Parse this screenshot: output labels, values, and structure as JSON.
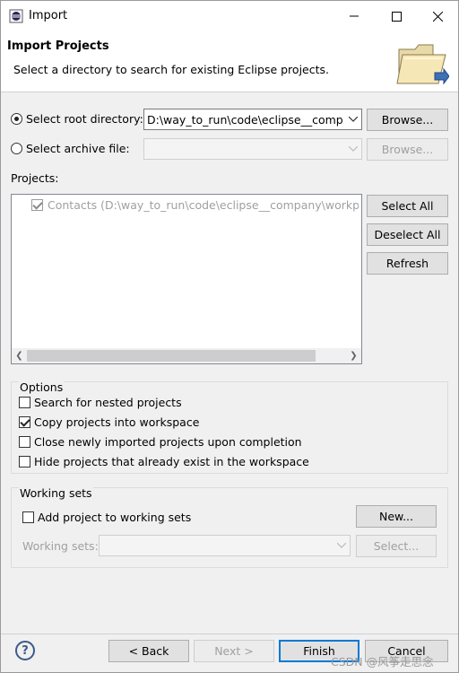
{
  "window": {
    "title": "Import"
  },
  "header": {
    "title": "Import Projects",
    "description": "Select a directory to search for existing Eclipse projects."
  },
  "source": {
    "root_dir_label": "Select root directory:",
    "root_dir_value": "D:\\way_to_run\\code\\eclipse__company\\workplace",
    "root_dir_checked": true,
    "archive_label": "Select archive file:",
    "archive_value": "",
    "archive_checked": false,
    "browse_label": "Browse...",
    "browse_disabled_label": "Browse..."
  },
  "projects": {
    "label": "Projects:",
    "items": [
      {
        "label": "Contacts (D:\\way_to_run\\code\\eclipse__company\\workplace\\Contacts)",
        "checked": true
      }
    ],
    "select_all_label": "Select All",
    "deselect_all_label": "Deselect All",
    "refresh_label": "Refresh"
  },
  "options": {
    "title": "Options",
    "items": [
      {
        "label": "Search for nested projects",
        "checked": false
      },
      {
        "label": "Copy projects into workspace",
        "checked": true
      },
      {
        "label": "Close newly imported projects upon completion",
        "checked": false
      },
      {
        "label": "Hide projects that already exist in the workspace",
        "checked": false
      }
    ]
  },
  "working_sets": {
    "title": "Working sets",
    "add_label": "Add project to working sets",
    "add_checked": false,
    "new_label": "New...",
    "sets_label": "Working sets:",
    "select_label": "Select..."
  },
  "footer": {
    "back_label": "< Back",
    "next_label": "Next >",
    "finish_label": "Finish",
    "cancel_label": "Cancel",
    "help_glyph": "?"
  },
  "watermark": "CSDN @风筝走思念",
  "icons": {
    "app": "eclipse-icon",
    "header": "folder-open-icon",
    "help": "help-icon"
  },
  "colors": {
    "default_button_border": "#0078d7",
    "disabled_text": "#a0a0a0"
  }
}
